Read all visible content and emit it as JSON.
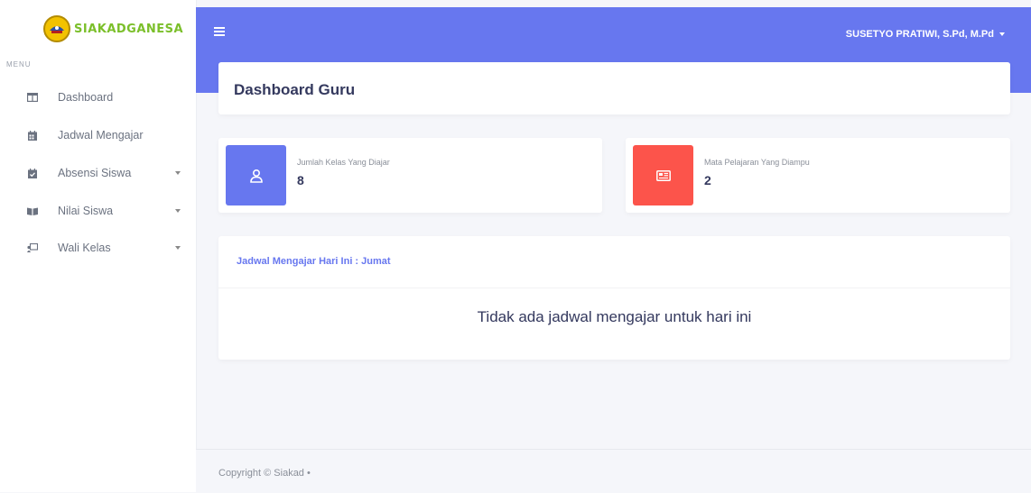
{
  "brand": {
    "name": "SIAKADGANESA"
  },
  "sidebar": {
    "heading": "MENU",
    "items": [
      {
        "label": "Dashboard",
        "icon": "columns-icon",
        "has_submenu": false
      },
      {
        "label": "Jadwal Mengajar",
        "icon": "calendar-icon",
        "has_submenu": false
      },
      {
        "label": "Absensi Siswa",
        "icon": "calendar-check-icon",
        "has_submenu": true
      },
      {
        "label": "Nilai Siswa",
        "icon": "book-open-icon",
        "has_submenu": true
      },
      {
        "label": "Wali Kelas",
        "icon": "chalkboard-teacher-icon",
        "has_submenu": true
      }
    ]
  },
  "header": {
    "menu_icon": "hamburger-icon",
    "user_name": "SUSETYO PRATIWI, S.Pd, M.Pd"
  },
  "page": {
    "title": "Dashboard Guru"
  },
  "stats": [
    {
      "label": "Jumlah Kelas Yang Diajar",
      "value": "8",
      "icon": "user-icon",
      "color": "#6777ef"
    },
    {
      "label": "Mata Pelajaran Yang Diampu",
      "value": "2",
      "icon": "newspaper-icon",
      "color": "#fc544b"
    }
  ],
  "schedule": {
    "title": "Jadwal Mengajar Hari Ini : Jumat",
    "empty_message": "Tidak ada jadwal mengajar untuk hari ini"
  },
  "footer": {
    "text": "Copyright © Siakad •"
  },
  "colors": {
    "primary": "#6777ef",
    "danger": "#fc544b",
    "brand_green": "#7bbf2a"
  }
}
